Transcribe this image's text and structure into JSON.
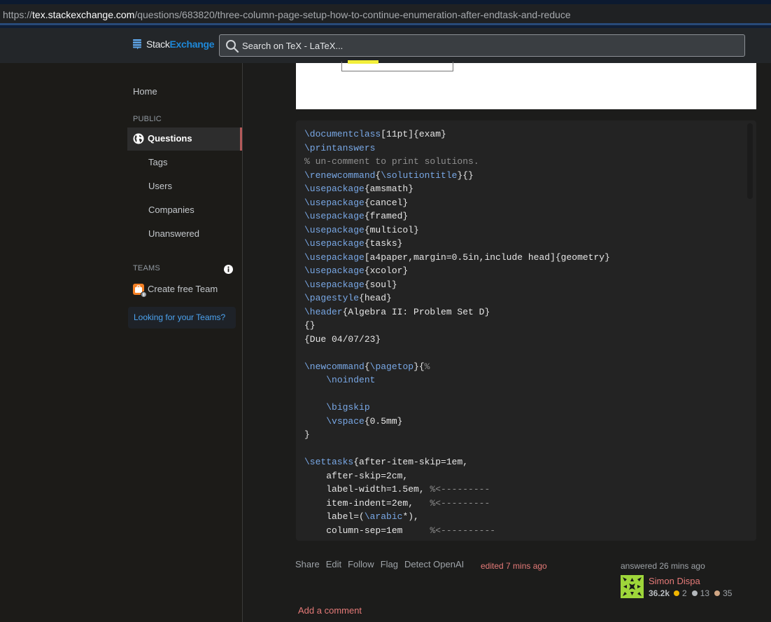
{
  "browser": {
    "url_scheme": "https://",
    "url_host": "tex.stackexchange.com",
    "url_path": "/questions/683820/three-column-page-setup-how-to-continue-enumeration-after-endtask-and-reduce"
  },
  "header": {
    "logo_part1": "Stack",
    "logo_part2": "Exchange",
    "search_placeholder": "Search on TeX - LaTeX...",
    "icons": {
      "search": "search-icon",
      "logo": "stack-exchange-icon",
      "avatar": "user-avatar"
    }
  },
  "sidebar": {
    "home": "Home",
    "public_heading": "PUBLIC",
    "questions": "Questions",
    "tags": "Tags",
    "users": "Users",
    "companies": "Companies",
    "unanswered": "Unanswered",
    "teams_heading": "TEAMS",
    "create_team": "Create free Team",
    "looking_teams": "Looking for your Teams?",
    "icons": {
      "questions": "globe-icon",
      "teams_info": "info-icon",
      "create_team": "briefcase-icon"
    }
  },
  "code_lines": [
    [
      [
        "kw",
        "\\documentclass"
      ],
      [
        "t",
        "[11pt]{exam}"
      ]
    ],
    [
      [
        "kw",
        "\\printanswers"
      ]
    ],
    [
      [
        "cm",
        "% un-comment to print solutions."
      ]
    ],
    [
      [
        "kw",
        "\\renewcommand"
      ],
      [
        "t",
        "{"
      ],
      [
        "kw",
        "\\solutiontitle"
      ],
      [
        "t",
        "}{}"
      ]
    ],
    [
      [
        "kw",
        "\\usepackage"
      ],
      [
        "t",
        "{amsmath}"
      ]
    ],
    [
      [
        "kw",
        "\\usepackage"
      ],
      [
        "t",
        "{cancel}"
      ]
    ],
    [
      [
        "kw",
        "\\usepackage"
      ],
      [
        "t",
        "{framed}"
      ]
    ],
    [
      [
        "kw",
        "\\usepackage"
      ],
      [
        "t",
        "{multicol}"
      ]
    ],
    [
      [
        "kw",
        "\\usepackage"
      ],
      [
        "t",
        "{tasks}"
      ]
    ],
    [
      [
        "kw",
        "\\usepackage"
      ],
      [
        "t",
        "[a4paper,margin=0.5in,include head]{geometry}"
      ]
    ],
    [
      [
        "kw",
        "\\usepackage"
      ],
      [
        "t",
        "{xcolor}"
      ]
    ],
    [
      [
        "kw",
        "\\usepackage"
      ],
      [
        "t",
        "{soul}"
      ]
    ],
    [
      [
        "kw",
        "\\pagestyle"
      ],
      [
        "t",
        "{head}"
      ]
    ],
    [
      [
        "kw",
        "\\header"
      ],
      [
        "t",
        "{Algebra II: Problem Set D}"
      ]
    ],
    [
      [
        "t",
        "{}"
      ]
    ],
    [
      [
        "t",
        "{Due 04/07/23}"
      ]
    ],
    [
      [
        "t",
        ""
      ]
    ],
    [
      [
        "kw",
        "\\newcommand"
      ],
      [
        "t",
        "{"
      ],
      [
        "kw",
        "\\pagetop"
      ],
      [
        "t",
        "}{"
      ],
      [
        "cm",
        "%"
      ]
    ],
    [
      [
        "t",
        "    "
      ],
      [
        "kw",
        "\\noindent"
      ]
    ],
    [
      [
        "t",
        ""
      ]
    ],
    [
      [
        "t",
        "    "
      ],
      [
        "kw",
        "\\bigskip"
      ]
    ],
    [
      [
        "t",
        "    "
      ],
      [
        "kw",
        "\\vspace"
      ],
      [
        "t",
        "{0.5mm}"
      ]
    ],
    [
      [
        "t",
        "}"
      ]
    ],
    [
      [
        "t",
        ""
      ]
    ],
    [
      [
        "kw",
        "\\settasks"
      ],
      [
        "t",
        "{after-item-skip=1em,"
      ]
    ],
    [
      [
        "t",
        "    after-skip=2cm,"
      ]
    ],
    [
      [
        "t",
        "    label-width=1.5em, "
      ],
      [
        "cm",
        "%<---------"
      ]
    ],
    [
      [
        "t",
        "    item-indent=2em,   "
      ],
      [
        "cm",
        "%<---------"
      ]
    ],
    [
      [
        "t",
        "    label=("
      ],
      [
        "kw",
        "\\arabic"
      ],
      [
        "t",
        "*),"
      ]
    ],
    [
      [
        "t",
        "    column-sep=1em     "
      ],
      [
        "cm",
        "%<----------"
      ]
    ]
  ],
  "post": {
    "actions": [
      "Share",
      "Edit",
      "Follow",
      "Flag",
      "Detect OpenAI"
    ],
    "edited": "edited 7 mins ago",
    "answered": "answered 26 mins ago",
    "user_name": "Simon Dispa",
    "reputation": "36.2k",
    "gold": "2",
    "silver": "13",
    "bronze": "35",
    "badge_colors": {
      "gold": "#f1b600",
      "silver": "#b4b8bc",
      "bronze": "#d1a684"
    },
    "add_comment": "Add a comment"
  }
}
